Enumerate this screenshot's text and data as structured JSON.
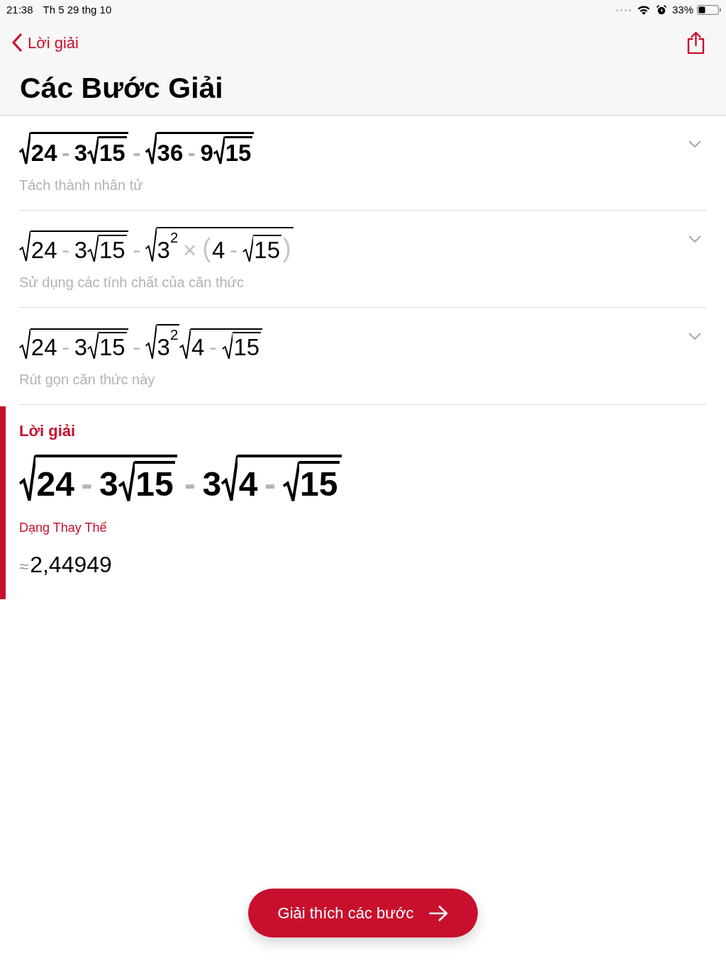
{
  "status_bar": {
    "time": "21:38",
    "date": "Th 5 29 thg 10",
    "battery_percent": "33%"
  },
  "nav_bar": {
    "back_label": "Lời giải",
    "title": "Các Bước Giải"
  },
  "steps": [
    {
      "bold": true,
      "expression": [
        {
          "kind": "sqrt",
          "body": [
            {
              "kind": "num",
              "text": "24"
            },
            {
              "kind": "op",
              "text": "-"
            },
            {
              "kind": "num",
              "text": "3"
            },
            {
              "kind": "sqrt",
              "body": [
                {
                  "kind": "num",
                  "text": "15"
                }
              ]
            }
          ]
        },
        {
          "kind": "op",
          "text": "-"
        },
        {
          "kind": "sqrt",
          "body": [
            {
              "kind": "num",
              "text": "36"
            },
            {
              "kind": "op",
              "text": "-"
            },
            {
              "kind": "num",
              "text": "9"
            },
            {
              "kind": "sqrt",
              "body": [
                {
                  "kind": "num",
                  "text": "15"
                }
              ]
            }
          ]
        }
      ],
      "description": "Tách thành nhân tử",
      "expanded": false
    },
    {
      "bold": false,
      "expression": [
        {
          "kind": "sqrt",
          "body": [
            {
              "kind": "num",
              "text": "24"
            },
            {
              "kind": "op",
              "text": "-"
            },
            {
              "kind": "num",
              "text": "3"
            },
            {
              "kind": "sqrt",
              "body": [
                {
                  "kind": "num",
                  "text": "15"
                }
              ]
            }
          ]
        },
        {
          "kind": "op",
          "text": "-"
        },
        {
          "kind": "sqrt",
          "body": [
            {
              "kind": "pow",
              "base": "3",
              "exponent": "2"
            },
            {
              "kind": "op",
              "text": "×"
            },
            {
              "kind": "paren",
              "open": "(",
              "close": ")",
              "body": [
                {
                  "kind": "num",
                  "text": "4"
                },
                {
                  "kind": "op",
                  "text": "-"
                },
                {
                  "kind": "sqrt",
                  "body": [
                    {
                      "kind": "num",
                      "text": "15"
                    }
                  ]
                }
              ]
            }
          ]
        }
      ],
      "description": "Sử dụng các tính chất của căn thức",
      "expanded": false
    },
    {
      "bold": false,
      "expression": [
        {
          "kind": "sqrt",
          "body": [
            {
              "kind": "num",
              "text": "24"
            },
            {
              "kind": "op",
              "text": "-"
            },
            {
              "kind": "num",
              "text": "3"
            },
            {
              "kind": "sqrt",
              "body": [
                {
                  "kind": "num",
                  "text": "15"
                }
              ]
            }
          ]
        },
        {
          "kind": "op",
          "text": "-"
        },
        {
          "kind": "sqrt",
          "body": [
            {
              "kind": "pow",
              "base": "3",
              "exponent": "2"
            }
          ]
        },
        {
          "kind": "sqrt",
          "body": [
            {
              "kind": "num",
              "text": "4"
            },
            {
              "kind": "op",
              "text": "-"
            },
            {
              "kind": "sqrt",
              "body": [
                {
                  "kind": "num",
                  "text": "15"
                }
              ]
            }
          ]
        }
      ],
      "description": "Rút gọn căn thức này",
      "expanded": false
    }
  ],
  "solution": {
    "label": "Lời giải",
    "expression": [
      {
        "kind": "sqrt",
        "body": [
          {
            "kind": "num",
            "text": "24"
          },
          {
            "kind": "op",
            "text": "-"
          },
          {
            "kind": "num",
            "text": "3"
          },
          {
            "kind": "sqrt",
            "body": [
              {
                "kind": "num",
                "text": "15"
              }
            ]
          }
        ]
      },
      {
        "kind": "op",
        "text": "-"
      },
      {
        "kind": "num",
        "text": "3"
      },
      {
        "kind": "sqrt",
        "body": [
          {
            "kind": "num",
            "text": "4"
          },
          {
            "kind": "op",
            "text": "-"
          },
          {
            "kind": "sqrt",
            "body": [
              {
                "kind": "num",
                "text": "15"
              }
            ]
          }
        ]
      }
    ],
    "alternate_label": "Dạng Thay Thế",
    "approx_sign": "≈",
    "approx_value": "2,44949"
  },
  "explain_button": {
    "label": "Giải thích các bước"
  }
}
